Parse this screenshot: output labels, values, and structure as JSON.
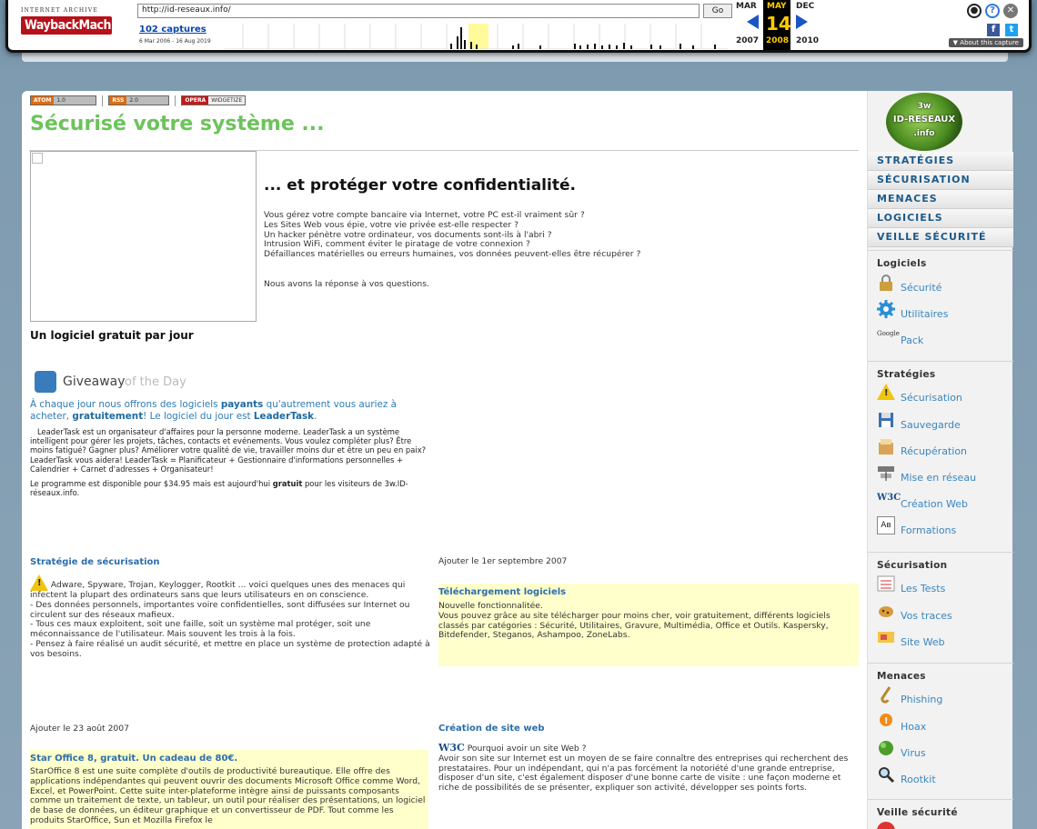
{
  "wayback": {
    "brand_top": "INTERNET ARCHIVE",
    "brand_main": "WaybackMachine",
    "url": "http://id-reseaux.info/",
    "go_label": "Go",
    "captures": "102 captures",
    "range": "6 Mar 2006 - 16 Aug 2019",
    "months": [
      "MAR",
      "MAY",
      "DEC"
    ],
    "day": "14",
    "years": [
      "2007",
      "2008",
      "2010"
    ],
    "about": "About this capture"
  },
  "bg_nav": "STRATÉGIES   SÉCURISATION",
  "feeds": {
    "atom": "ATOM",
    "atom_ver": "1.0",
    "rss": "RSS",
    "rss_ver": "2.0",
    "opera": "OPERA",
    "opera_widget": "WIDGETIZE"
  },
  "page_title": "Sécurisé votre système ...",
  "intro": {
    "heading": "... et protéger votre confidentialité.",
    "lines": [
      "Vous gérez votre compte bancaire via Internet, votre PC est-il vraiment sûr ?",
      "Les Sites Web vous épie, votre vie privée est-elle respecter ?",
      "Un hacker pénètre votre ordinateur, vos documents sont-ils à l'abri ?",
      "Intrusion WiFi, comment éviter le piratage de votre connexion ?",
      "Défaillances matérielles ou erreurs humaines, vos données peuvent-elles être récupérer ?"
    ],
    "answer": "Nous avons la réponse à vos questions."
  },
  "giveaway": {
    "heading": "Un logiciel gratuit par jour",
    "logo_main": "Giveaway",
    "logo_sub": "of the Day",
    "promo_a": "À chaque jour nous offrons des logiciels ",
    "promo_b": "payants",
    "promo_c": " qu'autrement vous auriez à acheter, ",
    "promo_d": "gratuitement",
    "promo_e": "! Le logiciel du jour est ",
    "promo_f": "LeaderTask",
    "promo_g": ".",
    "desc": "LeaderTask est un organisateur d'affaires pour la personne moderne. LeaderTask a un système intelligent pour gérer les projets, tâches, contacts et evénements. Vous voulez compléter plus? Être moins fatigué? Gagner plus? Améliorer votre qualité de vie, travailler moins dur et être un peu en paix? LeaderTask vous aidera! LeaderTask = Planificateur + Gestionnaire d'informations personnelles + Calendrier + Carnet d'adresses + Organisateur!",
    "price_a": "Le programme est disponible pour $34.95 mais est aujourd'hui ",
    "price_b": "gratuit",
    "price_c": " pour les visiteurs de 3w.ID-réseaux.info."
  },
  "articles": {
    "strategie": {
      "title": "Stratégie de sécurisation",
      "lead": "Adware, Spyware, Trojan, Keylogger, Rootkit ... voici quelques unes des menaces qui infectent la plupart des ordinateurs sans que leurs utilisateurs en on conscience.",
      "p1": "- Des données personnels, importantes voire confidentielles, sont diffusées sur Internet ou circulent sur des réseaux mafieux.",
      "p2": "- Tous ces maux exploitent, soit une faille, soit un système mal protéger, soit une méconnaissance de l'utilisateur. Mais souvent les trois à la fois.",
      "p3": "- Pensez à faire réalisé un audit sécurité, et mettre en place un système de protection adapté à vos besoins."
    },
    "date1": "Ajouter le 1er septembre 2007",
    "telechargement": {
      "title": "Téléchargement logiciels",
      "p1": "Nouvelle fonctionnalitée.",
      "p2": "Vous pouvez grâce au site télécharger pour moins cher, voir gratuitement, différents logiciels classés par catégories : Sécurité, Utilitaires, Gravure, Multimédia, Office et Outils. Kaspersky, Bitdefender, Steganos, Ashampoo, ZoneLabs."
    },
    "date2": "Ajouter le 23 août 2007",
    "creation": {
      "title": "Création de site web",
      "badge": "W3C",
      "lead": "Pourquoi avoir un site Web ?",
      "p1": "Avoir son site sur Internet est un moyen de se faire connaître des entreprises qui recherchent des prestataires. Pour un indépendant, qui n'a pas forcément la notoriété d'une grande entreprise, disposer d'un site, c'est également disposer d'une bonne carte de visite : une façon moderne et riche de possibilités de se présenter, expliquer son activité, développer ses points forts."
    },
    "staroffice": {
      "title": "Star Office 8, gratuit. Un cadeau de 80€.",
      "p1": "StarOffice 8 est une suite complète d'outils de productivité bureautique. Elle offre des applications indépendantes qui peuvent ouvrir des documents Microsoft Office comme Word, Excel, et PowerPoint. Cette suite inter-plateforme intègre ainsi de puissants composants comme un traitement de texte, un tableur, un outil pour réaliser des présentations, un logiciel de base de données, un éditeur graphique et un convertisseur de PDF. Tout comme les produits StarOffice, Sun et Mozilla Firefox le"
    }
  },
  "sidebar": {
    "logo_l1": "3w",
    "logo_l2": "ID-RESEAUX",
    "logo_l3": ".info",
    "nav": [
      "STRATÉGIES",
      "SÉCURISATION",
      "MENACES",
      "LOGICIELS",
      "VEILLE SÉCURITÉ"
    ],
    "groups": [
      {
        "title": "Logiciels",
        "items": [
          {
            "label": "Sécurité",
            "icon": "lock-icon"
          },
          {
            "label": "Utilitaires",
            "icon": "gear-icon"
          },
          {
            "label": "Pack",
            "icon": "google-icon"
          }
        ]
      },
      {
        "title": "Stratégies",
        "items": [
          {
            "label": "Sécurisation",
            "icon": "warning-icon"
          },
          {
            "label": "Sauvegarde",
            "icon": "floppy-icon"
          },
          {
            "label": "Récupération",
            "icon": "recovery-icon"
          },
          {
            "label": "Mise en réseau",
            "icon": "network-icon"
          },
          {
            "label": "Création Web",
            "icon": "w3c-icon"
          },
          {
            "label": "Formations",
            "icon": "font-icon"
          }
        ]
      },
      {
        "title": "Sécurisation",
        "items": [
          {
            "label": "Les Tests",
            "icon": "checklist-icon"
          },
          {
            "label": "Vos traces",
            "icon": "cookie-icon"
          },
          {
            "label": "Site Web",
            "icon": "web-icon"
          }
        ]
      },
      {
        "title": "Menaces",
        "items": [
          {
            "label": "Phishing",
            "icon": "hook-icon"
          },
          {
            "label": "Hoax",
            "icon": "alert-icon"
          },
          {
            "label": "Virus",
            "icon": "virus-icon"
          },
          {
            "label": "Rootkit",
            "icon": "magnifier-icon"
          }
        ]
      },
      {
        "title": "Veille sécurité",
        "items": []
      }
    ]
  }
}
